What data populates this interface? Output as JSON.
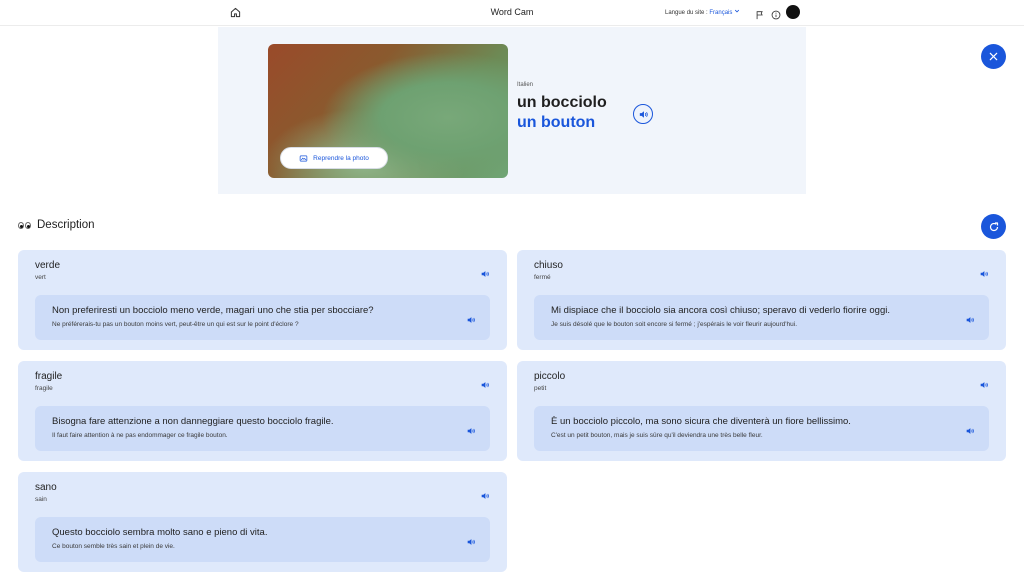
{
  "header": {
    "title": "Word Cam",
    "site_language_label": "Langue du site :",
    "site_language_value": "Français"
  },
  "hero": {
    "retake_label": "Reprendre la photo",
    "language": "Italien",
    "word": "un bocciolo",
    "translation": "un bouton"
  },
  "description": {
    "title": "Description"
  },
  "cards": [
    {
      "word": "verde",
      "translation": "vert",
      "sentence": "Non preferiresti un bocciolo meno verde, magari uno che stia per sbocciare?",
      "sentence_translation": "Ne préférerais-tu pas un bouton moins vert, peut-être un qui est sur le point d'éclore ?"
    },
    {
      "word": "chiuso",
      "translation": "fermé",
      "sentence": "Mi dispiace che il bocciolo sia ancora così chiuso; speravo di vederlo fiorire oggi.",
      "sentence_translation": "Je suis désolé que le bouton soit encore si fermé ; j'espérais le voir fleurir aujourd'hui."
    },
    {
      "word": "fragile",
      "translation": "fragile",
      "sentence": "Bisogna fare attenzione a non danneggiare questo bocciolo fragile.",
      "sentence_translation": "Il faut faire attention à ne pas endommager ce fragile bouton."
    },
    {
      "word": "piccolo",
      "translation": "petit",
      "sentence": "È un bocciolo piccolo, ma sono sicura che diventerà un fiore bellissimo.",
      "sentence_translation": "C'est un petit bouton, mais je suis sûre qu'il deviendra une très belle fleur."
    },
    {
      "word": "sano",
      "translation": "sain",
      "sentence": "Questo bocciolo sembra molto sano e pieno di vita.",
      "sentence_translation": "Ce bouton semble très sain et plein de vie."
    }
  ],
  "icons": {
    "home": "home-icon",
    "flag": "flag-icon",
    "info": "info-icon",
    "camera": "camera-icon",
    "speaker": "speaker-icon",
    "close": "close-icon",
    "refresh": "refresh-icon",
    "eyes": "eyes-icon"
  },
  "colors": {
    "accent": "#1a56db",
    "card_bg": "#dfe9fb",
    "example_bg": "#cddcf8",
    "hero_bg": "#f1f5fb"
  }
}
